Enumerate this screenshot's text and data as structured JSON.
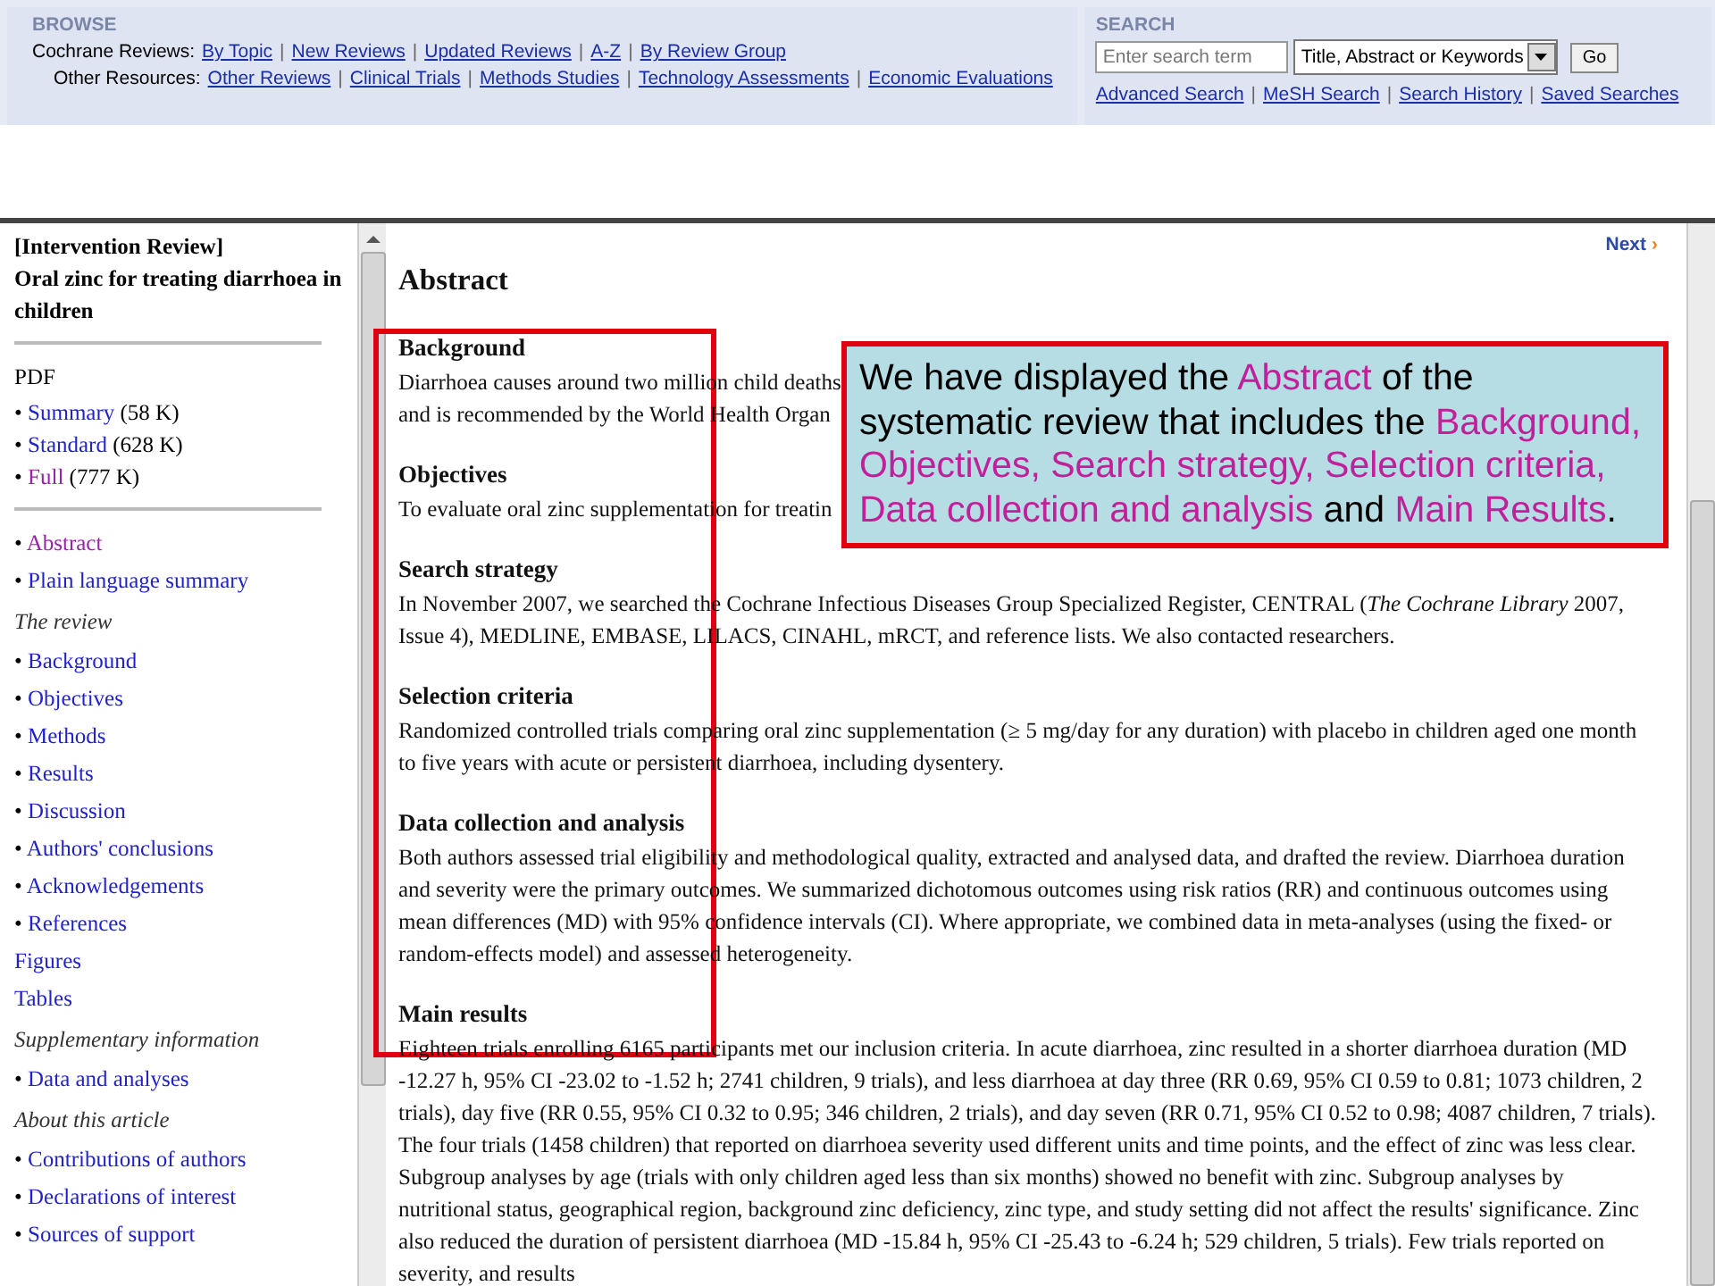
{
  "browse": {
    "title": "BROWSE",
    "rows": [
      {
        "label": "Cochrane Reviews:",
        "separator": "|",
        "links": [
          "By Topic",
          "New Reviews",
          "Updated Reviews",
          "A-Z",
          "By Review Group"
        ]
      },
      {
        "label": "Other Resources:",
        "separator": "|",
        "links": [
          "Other Reviews",
          "Clinical Trials",
          "Methods Studies",
          "Technology Assessments",
          "Economic Evaluations"
        ]
      }
    ]
  },
  "search": {
    "title": "SEARCH",
    "placeholder": "Enter search term",
    "scope": "Title, Abstract or Keywords",
    "button": "Go",
    "separator": "|",
    "links": [
      "Advanced Search",
      "MeSH Search",
      "Search History",
      "Saved Searches"
    ]
  },
  "sidebar": {
    "type_label": "[Intervention Review]",
    "title": "Oral zinc for treating diarrhoea in children",
    "items": [
      {
        "kind": "divider"
      },
      {
        "kind": "heading",
        "text": "PDF"
      },
      {
        "kind": "bullet",
        "bullet": "•",
        "text": "Summary",
        "size": "(58 K)",
        "visited": false
      },
      {
        "kind": "bullet",
        "bullet": "•",
        "text": "Standard",
        "size": "(628 K)",
        "visited": false
      },
      {
        "kind": "bullet",
        "bullet": "•",
        "text": "Full",
        "size": "(777 K)",
        "visited": true
      },
      {
        "kind": "divider"
      },
      {
        "kind": "bullet",
        "bullet": "•",
        "text": "Abstract",
        "visited": true
      },
      {
        "kind": "bullet",
        "bullet": "•",
        "text": "Plain language summary",
        "visited": false
      },
      {
        "kind": "section",
        "text": "The review"
      },
      {
        "kind": "bullet",
        "bullet": "•",
        "text": "Background",
        "visited": false
      },
      {
        "kind": "bullet",
        "bullet": "•",
        "text": "Objectives",
        "visited": false
      },
      {
        "kind": "bullet",
        "bullet": "•",
        "text": "Methods",
        "visited": false
      },
      {
        "kind": "bullet",
        "bullet": "•",
        "text": "Results",
        "visited": false
      },
      {
        "kind": "bullet",
        "bullet": "•",
        "text": "Discussion",
        "visited": false
      },
      {
        "kind": "bullet",
        "bullet": "•",
        "text": "Authors' conclusions",
        "visited": false
      },
      {
        "kind": "bullet",
        "bullet": "•",
        "text": "Acknowledgements",
        "visited": false
      },
      {
        "kind": "bullet",
        "bullet": "•",
        "text": "References",
        "visited": false
      },
      {
        "kind": "link",
        "text": "Figures",
        "visited": false
      },
      {
        "kind": "link",
        "text": "Tables",
        "visited": false
      },
      {
        "kind": "section",
        "text": "Supplementary information"
      },
      {
        "kind": "bullet",
        "bullet": "•",
        "text": "Data and analyses",
        "visited": false
      },
      {
        "kind": "section",
        "text": "About this article"
      },
      {
        "kind": "bullet",
        "bullet": "•",
        "text": "Contributions of authors",
        "visited": false
      },
      {
        "kind": "bullet",
        "bullet": "•",
        "text": "Declarations of interest",
        "visited": false
      },
      {
        "kind": "bullet",
        "bullet": "•",
        "text": "Sources of support",
        "visited": false
      }
    ]
  },
  "article": {
    "next": "Next",
    "next_arrow": "›",
    "title": "Abstract",
    "sections": [
      {
        "heading": "Background",
        "lines": [
          "Diarrhoea causes around two million child deaths",
          "and is recommended by the World Health Organ"
        ]
      },
      {
        "heading": "Objectives",
        "lines": [
          "To evaluate oral zinc supplementation for treatin"
        ]
      },
      {
        "heading": "Search strategy",
        "text": "In November 2007, we searched the Cochrane Infectious Diseases Group Specialized Register, CENTRAL (*The Cochrane Library* 2007, Issue 4), MEDLINE, EMBASE, LILACS, CINAHL, mRCT, and reference lists. We also contacted researchers."
      },
      {
        "heading": "Selection criteria",
        "text": "Randomized controlled trials comparing oral zinc supplementation (≥ 5 mg/day for any duration) with placebo in children aged one month to five years with acute or persistent diarrhoea, including dysentery."
      },
      {
        "heading": "Data collection and analysis",
        "text": "Both authors assessed trial eligibility and methodological quality, extracted and analysed data, and drafted the review. Diarrhoea duration and severity were the primary outcomes. We summarized dichotomous outcomes using risk ratios (RR) and continuous outcomes using mean differences (MD) with 95% confidence intervals (CI). Where appropriate, we combined data in meta-analyses (using the fixed- or random-effects model) and assessed heterogeneity."
      },
      {
        "heading": "Main results",
        "text": "Eighteen trials enrolling 6165 participants met our inclusion criteria. In acute diarrhoea, zinc resulted in a shorter diarrhoea duration (MD -12.27 h, 95% CI -23.02 to -1.52 h; 2741 children, 9 trials), and less diarrhoea at day three (RR 0.69, 95% CI 0.59 to 0.81; 1073 children, 2 trials), day five (RR 0.55, 95% CI 0.32 to 0.95; 346 children, 2 trials), and day seven (RR 0.71, 95% CI 0.52 to 0.98; 4087 children, 7 trials). The four trials (1458 children) that reported on diarrhoea severity used different units and time points, and the effect of zinc was less clear. Subgroup analyses by age (trials with only children aged less than six months) showed no benefit with zinc. Subgroup analyses by nutritional status, geographical region, background zinc deficiency, zinc type, and study setting did not affect the results' significance. Zinc also reduced the duration of persistent diarrhoea (MD -15.84 h, 95% CI -25.43 to -6.24 h; 529 children, 5 trials). Few trials reported on severity, and results"
      }
    ]
  },
  "callout": {
    "segments": [
      {
        "text": "We have displayed the ",
        "highlight": false
      },
      {
        "text": "Abstract",
        "highlight": true
      },
      {
        "text": " of the systematic review that includes the ",
        "highlight": false
      },
      {
        "text": "Background, Objectives, Search strategy, Selection criteria, Data collection and analysis",
        "highlight": true
      },
      {
        "text": " and ",
        "highlight": false
      },
      {
        "text": "Main Results",
        "highlight": true
      },
      {
        "text": ".",
        "highlight": false
      }
    ]
  }
}
